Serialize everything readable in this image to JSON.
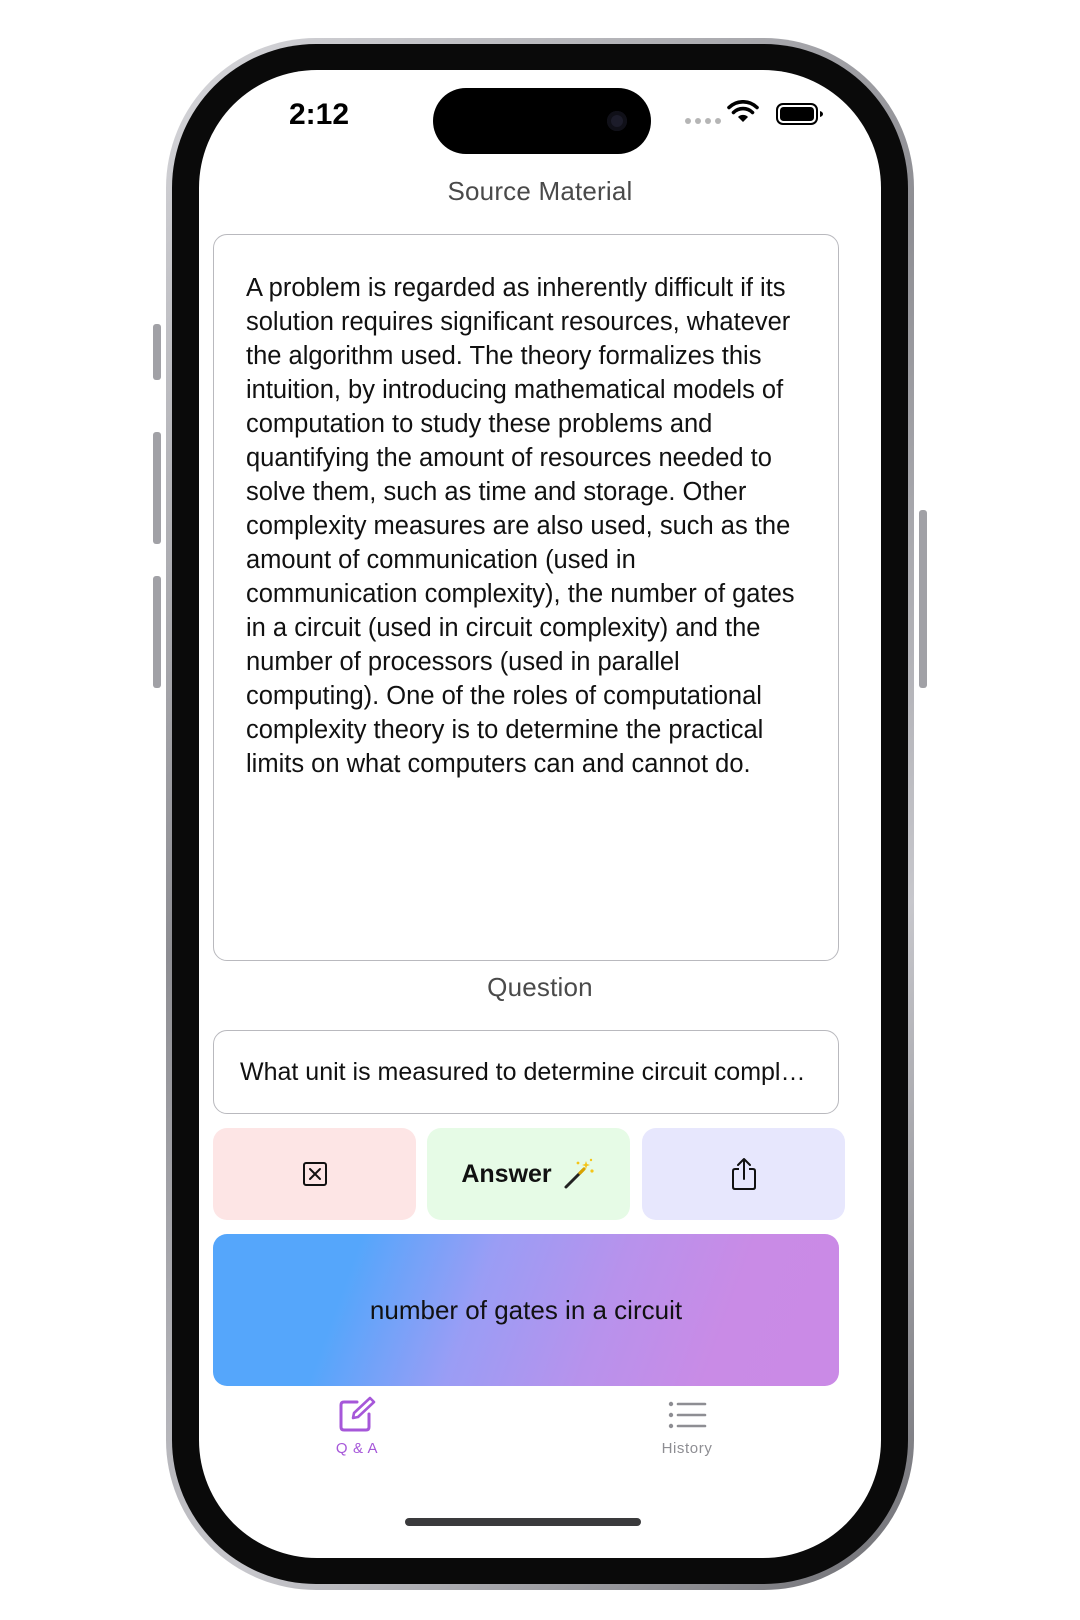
{
  "status_bar": {
    "time": "2:12"
  },
  "source": {
    "label": "Source Material",
    "text": "A problem is regarded as inherently difficult if its solution requires significant resources, whatever the algorithm used. The theory formalizes this intuition, by introducing mathematical models of computation to study these problems and quantifying the amount of resources needed to solve them, such as time and storage. Other complexity measures are also used, such as the amount of communication (used in communication complexity), the number of gates in a circuit (used in circuit complexity) and the number of processors (used in parallel computing). One of the roles of computational complexity theory is to determine the practical limits on what computers can and cannot do."
  },
  "question": {
    "label": "Question",
    "value": "What unit is measured to determine circuit complexity?"
  },
  "actions": {
    "clear_icon": "clear-square-icon",
    "answer_label": "Answer",
    "answer_icon": "magic-wand-icon",
    "share_icon": "share-icon"
  },
  "answer": {
    "text": "number of gates in a circuit"
  },
  "tabs": [
    {
      "label": "Q & A",
      "icon": "compose-icon",
      "active": true
    },
    {
      "label": "History",
      "icon": "list-icon",
      "active": false
    }
  ],
  "colors": {
    "accent": "#a657d9",
    "clear_bg": "#fde5e5",
    "answer_bg": "#e6fbe6",
    "share_bg": "#e7e7fd",
    "gradient_start": "#55a6fb",
    "gradient_end": "#ca8ae6"
  }
}
